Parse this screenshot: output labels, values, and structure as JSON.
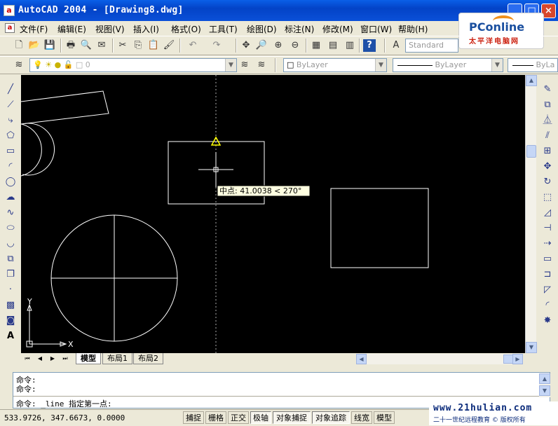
{
  "window": {
    "title": "AutoCAD 2004 - [Drawing8.dwg]",
    "min": "_",
    "max": "□",
    "close": "×"
  },
  "logo": {
    "text": "PConline",
    "sub": "太平洋电脑网"
  },
  "menu": [
    "文件(F)",
    "编辑(E)",
    "视图(V)",
    "插入(I)",
    "格式(O)",
    "工具(T)",
    "绘图(D)",
    "标注(N)",
    "修改(M)",
    "窗口(W)",
    "帮助(H)"
  ],
  "toolbar": {
    "text_style": "Standard"
  },
  "layers": {
    "current_layer": "0",
    "color": "ByLayer",
    "linetype": "ByLayer",
    "lineweight": "ByLa"
  },
  "canvas": {
    "osnap_tooltip": "中点: 41.0038 < 270°",
    "ucs_x": "X",
    "ucs_y": "Y"
  },
  "tabs": [
    "模型",
    "布局1",
    "布局2"
  ],
  "command": {
    "line1": "命令:",
    "line2": "命令:",
    "line3": "命令: _line 指定第一点:"
  },
  "status": {
    "coords": "533.9726, 347.6673, 0.0000",
    "buttons": [
      "捕捉",
      "栅格",
      "正交",
      "极轴",
      "对象捕捉",
      "对象追踪",
      "线宽",
      "模型"
    ]
  },
  "watermark": {
    "url": "www.21hulian.com",
    "note": "二十一世纪远程教育 © 版权所有"
  },
  "colors": {
    "titlebar": "#0a50d8",
    "canvas": "#000000",
    "snap_marker": "#ffff00"
  }
}
